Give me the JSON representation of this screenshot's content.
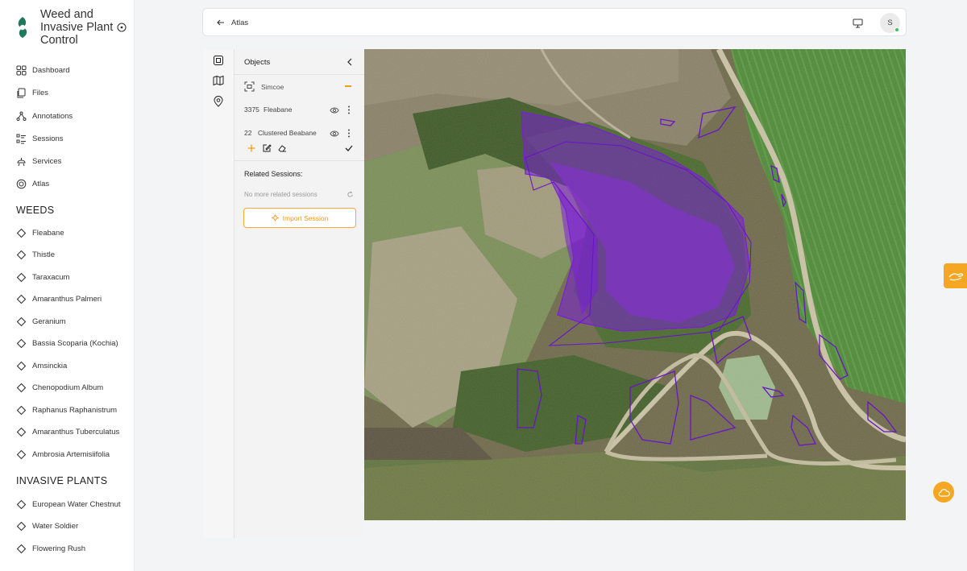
{
  "app": {
    "title": "Weed and Invasive Plant Control",
    "brand_color": "#1f7a5c"
  },
  "nav": [
    {
      "label": "Dashboard",
      "icon": "grid-icon"
    },
    {
      "label": "Files",
      "icon": "files-icon"
    },
    {
      "label": "Annotations",
      "icon": "annotations-icon"
    },
    {
      "label": "Sessions",
      "icon": "sessions-icon"
    },
    {
      "label": "Services",
      "icon": "services-icon"
    },
    {
      "label": "Atlas",
      "icon": "atlas-icon"
    }
  ],
  "weeds": {
    "heading": "WEEDS",
    "items": [
      "Fleabane",
      "Thistle",
      "Taraxacum",
      "Amaranthus Palmeri",
      "Geranium",
      "Bassia Scoparia (Kochia)",
      "Amsinckia",
      "Chenopodium Album",
      "Raphanus Raphanistrum",
      "Amaranthus Tuberculatus",
      "Ambrosia Artemisiifolia"
    ]
  },
  "invasive": {
    "heading": "INVASIVE PLANTS",
    "items": [
      "European Water Chestnut",
      "Water Soldier",
      "Flowering Rush"
    ]
  },
  "topbar": {
    "breadcrumb": "Atlas",
    "avatar_initial": "S"
  },
  "panel": {
    "title": "Objects",
    "group": {
      "name": "Simcoe"
    },
    "objects": [
      {
        "count": "3375",
        "name": "Fleabane"
      },
      {
        "count": "22",
        "name": "Clustered Beabane"
      }
    ],
    "related_title": "Related Sessions:",
    "related_empty": "No more related sessions",
    "import_label": "Import Session"
  },
  "colors": {
    "accent": "#f29b1d",
    "annotation": "#7a1fd6",
    "status_online": "#3bc15a"
  }
}
